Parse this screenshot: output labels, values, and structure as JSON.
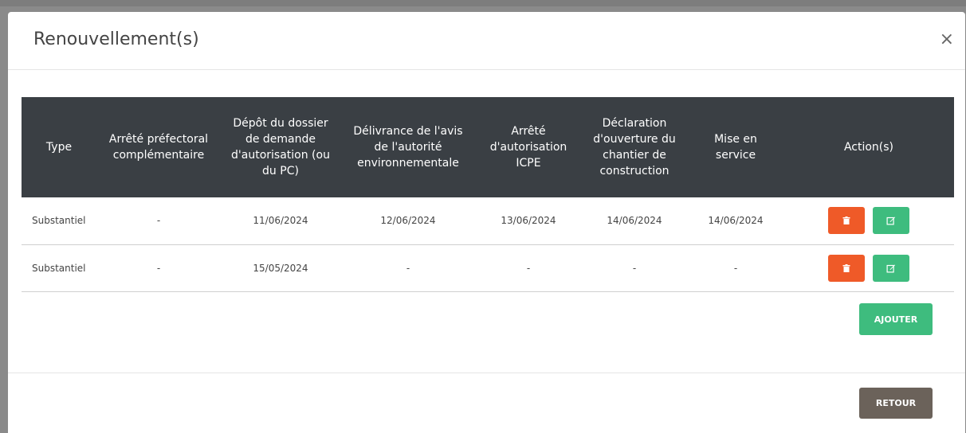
{
  "modal": {
    "title": "Renouvellement(s)",
    "close_symbol": "×"
  },
  "table": {
    "headers": [
      "Type",
      "Arrêté préfectoral complémentaire",
      "Dépôt du dossier de demande d'autorisation (ou du PC)",
      "Délivrance de l'avis de l'autorité environnementale",
      "Arrêté d'autorisation ICPE",
      "Déclaration d'ouverture du chantier de construction",
      "Mise en service",
      "Action(s)"
    ],
    "rows": [
      [
        "Substantiel",
        "-",
        "11/06/2024",
        "12/06/2024",
        "13/06/2024",
        "14/06/2024",
        "14/06/2024"
      ],
      [
        "Substantiel",
        "-",
        "15/05/2024",
        "-",
        "-",
        "-",
        "-"
      ]
    ]
  },
  "actions": {
    "delete_icon": "trash-icon",
    "edit_icon": "edit-icon"
  },
  "buttons": {
    "add_label": "AJOUTER",
    "back_label": "RETOUR"
  },
  "colors": {
    "header_bg": "#3a3f44",
    "delete": "#ef5a28",
    "edit": "#3ebc7e",
    "add": "#3ebc7e",
    "back": "#6b625a"
  }
}
